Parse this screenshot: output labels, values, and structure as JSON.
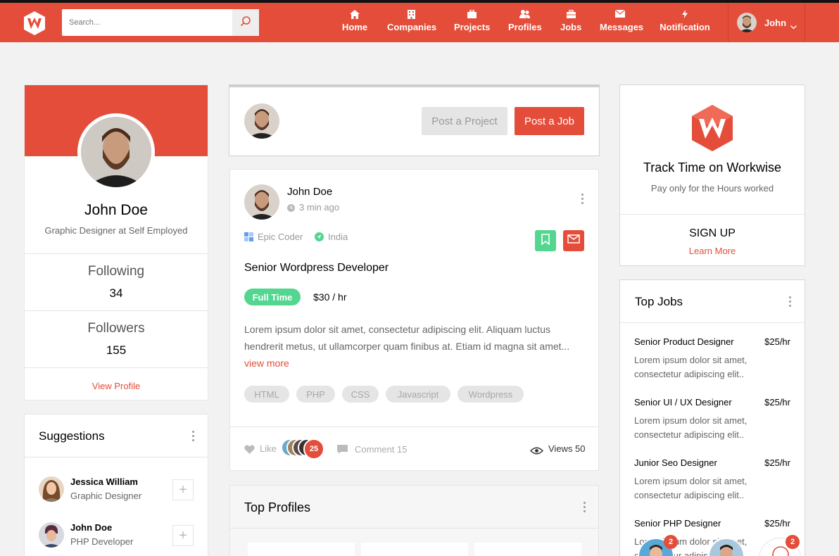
{
  "nav": {
    "search_placeholder": "Search...",
    "items": [
      {
        "label": "Home",
        "icon": "home-icon"
      },
      {
        "label": "Companies",
        "icon": "building-icon"
      },
      {
        "label": "Projects",
        "icon": "briefcase-icon"
      },
      {
        "label": "Profiles",
        "icon": "users-icon"
      },
      {
        "label": "Jobs",
        "icon": "suitcase-icon"
      },
      {
        "label": "Messages",
        "icon": "envelope-icon"
      },
      {
        "label": "Notification",
        "icon": "bolt-icon"
      }
    ],
    "user_name": "John"
  },
  "profile": {
    "name": "John Doe",
    "title": "Graphic Designer at Self Employed",
    "following_label": "Following",
    "following_count": "34",
    "followers_label": "Followers",
    "followers_count": "155",
    "view_profile": "View Profile"
  },
  "suggestions": {
    "title": "Suggestions",
    "items": [
      {
        "name": "Jessica William",
        "role": "Graphic Designer"
      },
      {
        "name": "John Doe",
        "role": "PHP Developer"
      }
    ]
  },
  "composer": {
    "post_project": "Post a Project",
    "post_job": "Post a Job"
  },
  "post": {
    "user": "John Doe",
    "time": "3 min ago",
    "company": "Epic Coder",
    "location": "India",
    "title": "Senior Wordpress Developer",
    "job_type": "Full Time",
    "rate": "$30 / hr",
    "description": "Lorem ipsum dolor sit amet, consectetur adipiscing elit. Aliquam luctus hendrerit metus, ut ullamcorper quam finibus at. Etiam id magna sit amet...",
    "view_more": "view more",
    "tags": [
      "HTML",
      "PHP",
      "CSS",
      "Javascript",
      "Wordpress"
    ],
    "like_label": "Like",
    "like_count": "25",
    "comment_label": "Comment 15",
    "views_label": "Views 50"
  },
  "top_profiles": {
    "title": "Top Profiles"
  },
  "track_time": {
    "title": "Track Time on Workwise",
    "subtitle": "Pay only for the Hours worked",
    "sign_up": "SIGN UP",
    "learn_more": "Learn More"
  },
  "top_jobs": {
    "title": "Top Jobs",
    "items": [
      {
        "title": "Senior Product Designer",
        "rate": "$25/hr",
        "desc": "Lorem ipsum dolor sit amet, consectetur adipiscing elit.."
      },
      {
        "title": "Senior UI / UX Designer",
        "rate": "$25/hr",
        "desc": "Lorem ipsum dolor sit amet, consectetur adipiscing elit.."
      },
      {
        "title": "Junior Seo Designer",
        "rate": "$25/hr",
        "desc": "Lorem ipsum dolor sit amet, consectetur adipiscing elit.."
      },
      {
        "title": "Senior PHP Designer",
        "rate": "$25/hr",
        "desc": "Lorem ipsum dolor sit amet, consectetur adipiscing elit.."
      }
    ]
  },
  "chat": {
    "badge_1": "2",
    "badge_2": "2"
  },
  "colors": {
    "brand": "#e44d3a",
    "success": "#53d690"
  }
}
